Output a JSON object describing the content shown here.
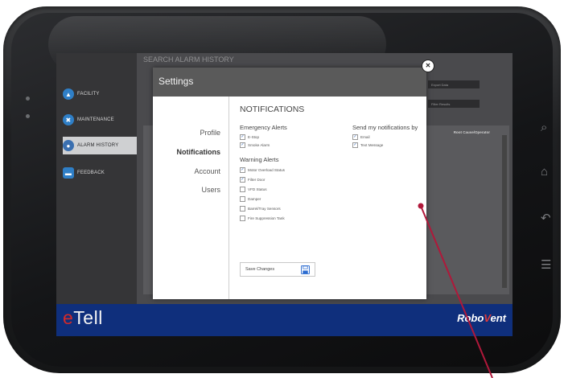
{
  "app": {
    "brand_left_e": "e",
    "brand_left_rest": "Tell",
    "brand_right_robo": "Robo",
    "brand_right_v": "V",
    "brand_right_ent": "ent"
  },
  "nav": [
    {
      "label": "FACILITY",
      "icon": "building-icon"
    },
    {
      "label": "MAINTENANCE",
      "icon": "wrench-icon"
    },
    {
      "label": "ALARM HISTORY",
      "icon": "alarm-bell-icon",
      "active": true
    },
    {
      "label": "FEEDBACK",
      "icon": "chat-icon"
    }
  ],
  "background": {
    "title": "SEARCH ALARM HISTORY",
    "export_button": "Export Data",
    "filter_button": "Filter Results",
    "column_header": "Root Cause/Operator"
  },
  "modal": {
    "title": "Settings",
    "close": "✕",
    "menu": [
      "Profile",
      "Notifications",
      "Account",
      "Users"
    ],
    "active_menu": "Notifications",
    "section_title": "NOTIFICATIONS",
    "emergency": {
      "title": "Emergency Alerts",
      "items": [
        {
          "label": "E-Stop",
          "checked": true
        },
        {
          "label": "Smoke Alarm",
          "checked": true
        }
      ]
    },
    "send_by": {
      "title": "Send my notifications by",
      "items": [
        {
          "label": "Email",
          "checked": true
        },
        {
          "label": "Text Message",
          "checked": true
        }
      ]
    },
    "warning": {
      "title": "Warning Alerts",
      "items": [
        {
          "label": "Motor Overload Status",
          "checked": true
        },
        {
          "label": "Filter Door",
          "checked": true
        },
        {
          "label": "VFD Status",
          "checked": false
        },
        {
          "label": "Damper",
          "checked": false
        },
        {
          "label": "Barrel/Tray Sensors",
          "checked": false
        },
        {
          "label": "Fire Suppression Tank",
          "checked": false
        }
      ]
    },
    "save_label": "Save Changes"
  },
  "colors": {
    "footer": "#0f2f7c",
    "accent_red": "#d22a2a",
    "callout": "#b0183a"
  }
}
